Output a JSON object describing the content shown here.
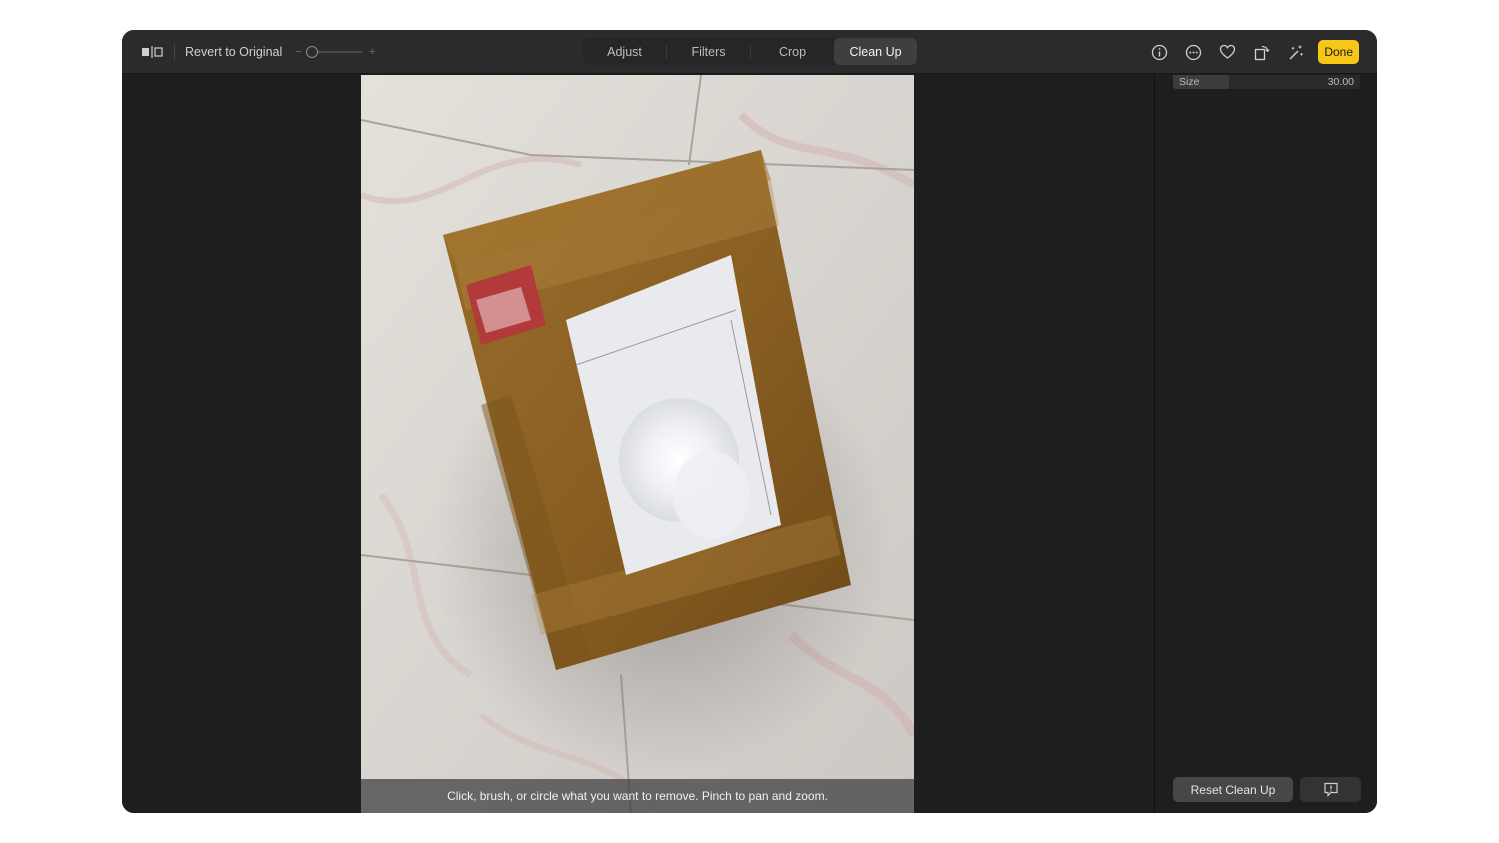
{
  "toolbar": {
    "compare_icon": "compare-split-icon",
    "revert_label": "Revert to Original",
    "zoom": {
      "minus": "−",
      "plus": "+",
      "level": 0.0
    },
    "tabs": [
      {
        "label": "Adjust",
        "active": false
      },
      {
        "label": "Filters",
        "active": false
      },
      {
        "label": "Crop",
        "active": false
      },
      {
        "label": "Clean Up",
        "active": true
      }
    ],
    "right_icons": [
      "info-icon",
      "more-icon",
      "heart-icon",
      "rotate-icon",
      "magic-wand-icon"
    ],
    "done_label": "Done"
  },
  "canvas": {
    "hint": "Click, brush, or circle what you want to remove. Pinch to pan and zoom."
  },
  "sidebar": {
    "size": {
      "label": "Size",
      "value": "30.00",
      "fraction": 0.3
    },
    "reset_label": "Reset Clean Up",
    "feedback_icon": "feedback-icon"
  },
  "colors": {
    "accent": "#f7c717",
    "window_bg": "#1e1e1e",
    "toolbar_bg": "#2b2b2b"
  }
}
